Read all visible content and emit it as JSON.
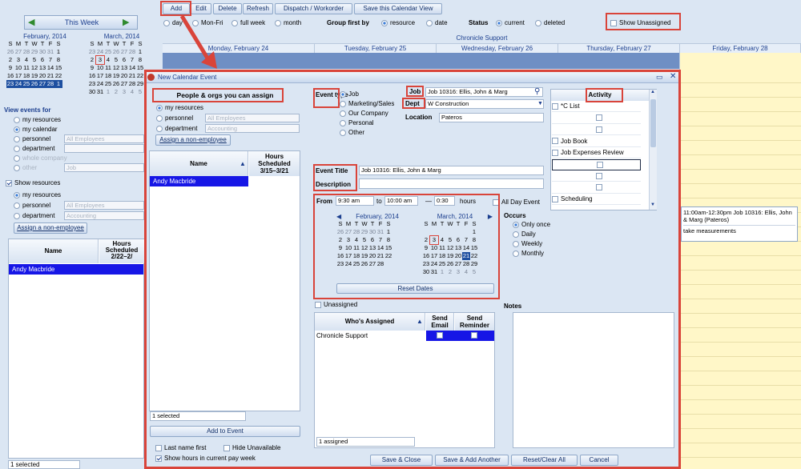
{
  "toolbar": {
    "add": "Add",
    "edit": "Edit",
    "delete": "Delete",
    "refresh": "Refresh",
    "dispatch": "Dispatch / Workorder",
    "save_view": "Save this Calendar View"
  },
  "view_range": {
    "label": "This Week"
  },
  "view_opts": {
    "day": "day",
    "mon_fri": "Mon-Fri",
    "full_week": "full week",
    "month": "month"
  },
  "group": {
    "label": "Group first by",
    "resource": "resource",
    "date": "date"
  },
  "status": {
    "label": "Status",
    "current": "current",
    "deleted": "deleted"
  },
  "show_unassigned": "Show Unassigned",
  "chronicle_support": "Chronicle Support",
  "days": [
    "Monday, February 24",
    "Tuesday, February 25",
    "Wednesday, February 26",
    "Thursday, February 27",
    "Friday, February 28"
  ],
  "event_block": {
    "line1": "11:00am-12:30pm Job 10316: Ellis, John & Marg (Pateros)",
    "line2": "take measurements"
  },
  "left_cal": {
    "feb_title": "February, 2014",
    "mar_title": "March, 2014",
    "dow": [
      "S",
      "M",
      "T",
      "W",
      "T",
      "F",
      "S"
    ],
    "feb": [
      [
        "26",
        "27",
        "28",
        "29",
        "30",
        "31",
        "1"
      ],
      [
        "2",
        "3",
        "4",
        "5",
        "6",
        "7",
        "8"
      ],
      [
        "9",
        "10",
        "11",
        "12",
        "13",
        "14",
        "15"
      ],
      [
        "16",
        "17",
        "18",
        "19",
        "20",
        "21",
        "22"
      ],
      [
        "23",
        "24",
        "25",
        "26",
        "27",
        "28",
        "1"
      ]
    ],
    "mar": [
      [
        "23",
        "24",
        "25",
        "26",
        "27",
        "28",
        "1"
      ],
      [
        "2",
        "3",
        "4",
        "5",
        "6",
        "7",
        "8"
      ],
      [
        "9",
        "10",
        "11",
        "12",
        "13",
        "14",
        "15"
      ],
      [
        "16",
        "17",
        "18",
        "19",
        "20",
        "21",
        "22"
      ],
      [
        "23",
        "24",
        "25",
        "26",
        "27",
        "28",
        "29"
      ],
      [
        "30",
        "31",
        "1",
        "2",
        "3",
        "4",
        "5"
      ]
    ]
  },
  "view_events": {
    "title": "View events for",
    "my_resources": "my resources",
    "my_calendar": "my calendar",
    "personnel": "personnel",
    "personnel_val": "All Employees",
    "department": "department",
    "whole_company": "whole company",
    "other": "other",
    "other_val": "Job"
  },
  "show_resources": {
    "label": "Show resources",
    "my_resources": "my resources",
    "personnel": "personnel",
    "personnel_val": "All Employees",
    "department": "department",
    "department_val": "Accounting",
    "assign": "Assign a non-employee"
  },
  "left_grid": {
    "name": "Name",
    "hours": "Hours Scheduled 2/22–2/",
    "row": "Andy Macbride"
  },
  "left_footer": "1 selected",
  "dialog": {
    "title": "New Calendar Event",
    "people_title": "People & orgs you can assign",
    "my_resources": "my resources",
    "personnel": "personnel",
    "personnel_val": "All Employees",
    "department": "department",
    "department_val": "Accounting",
    "assign": "Assign a non-employee",
    "grid_name": "Name",
    "grid_hours": "Hours Scheduled 3/15–3/21",
    "grid_row": "Andy Macbride",
    "selected": "1 selected",
    "add_to_event": "Add to Event",
    "last_name_first": "Last name first",
    "hide_unavailable": "Hide Unavailable",
    "show_hours": "Show hours in current pay week",
    "event_type": "Event type",
    "types": [
      "Job",
      "Marketing/Sales",
      "Our Company",
      "Personal",
      "Other"
    ],
    "job_label": "Job",
    "job_val": "Job 10316: Ellis, John & Marg",
    "dept_label": "Dept",
    "dept_val": "W Construction",
    "location_label": "Location",
    "location_val": "Pateros",
    "event_title_label": "Event Title",
    "event_title_val": "Job 10316: Ellis, John & Marg",
    "description_label": "Description",
    "from_label": "From",
    "from_time": "9:30 am",
    "to_label": "to",
    "to_time": "10:00 am",
    "dash": "—",
    "duration": "0:30",
    "hours": "hours",
    "all_day": "All Day Event",
    "reset_dates": "Reset Dates",
    "occurs": "Occurs",
    "occurs_opts": [
      "Only once",
      "Daily",
      "Weekly",
      "Monthly"
    ],
    "unassigned": "Unassigned",
    "whos_assigned": "Who's Assigned",
    "send_email": "Send Email",
    "send_reminder": "Send Reminder",
    "assigned_row": "Chronicle Support",
    "assigned_count": "1 assigned",
    "notes": "Notes",
    "activity": "Activity",
    "activities": [
      "*C List",
      "",
      "",
      "Job Book",
      "Job Expenses Review",
      "",
      "",
      "",
      "Scheduling"
    ],
    "save_close": "Save & Close",
    "save_add": "Save & Add Another",
    "reset_clear": "Reset/Clear All",
    "cancel": "Cancel"
  },
  "dlg_cal": {
    "feb_title": "February, 2014",
    "mar_title": "March, 2014",
    "feb": [
      [
        "26",
        "27",
        "28",
        "29",
        "30",
        "31",
        "1"
      ],
      [
        "2",
        "3",
        "4",
        "5",
        "6",
        "7",
        "8"
      ],
      [
        "9",
        "10",
        "11",
        "12",
        "13",
        "14",
        "15"
      ],
      [
        "16",
        "17",
        "18",
        "19",
        "20",
        "21",
        "22"
      ],
      [
        "23",
        "24",
        "25",
        "26",
        "27",
        "28",
        ""
      ]
    ],
    "mar": [
      [
        "",
        "",
        "",
        "",
        "",
        "",
        "1"
      ],
      [
        "2",
        "3",
        "4",
        "5",
        "6",
        "7",
        "8"
      ],
      [
        "9",
        "10",
        "11",
        "12",
        "13",
        "14",
        "15"
      ],
      [
        "16",
        "17",
        "18",
        "19",
        "20",
        "21",
        "22"
      ],
      [
        "23",
        "24",
        "25",
        "26",
        "27",
        "28",
        "29"
      ],
      [
        "30",
        "31",
        "1",
        "2",
        "3",
        "4",
        "5"
      ]
    ]
  },
  "bottom_status": "1 selected"
}
